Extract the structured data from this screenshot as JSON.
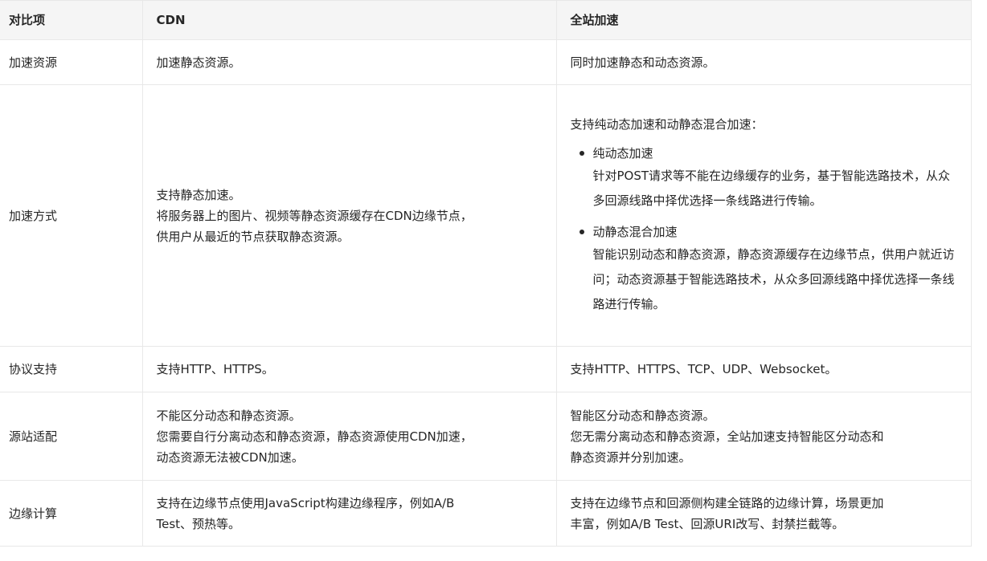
{
  "table": {
    "headers": [
      "对比项",
      "CDN",
      "全站加速"
    ],
    "rows": {
      "resource": {
        "item": "加速资源",
        "cdn": [
          "加速静态资源。"
        ],
        "dcdn": [
          "同时加速静态和动态资源。"
        ]
      },
      "method": {
        "item": "加速方式",
        "cdn": [
          "支持静态加速。",
          "将服务器上的图片、视频等静态资源缓存在CDN边缘节点，",
          "供用户从最近的节点获取静态资源。"
        ],
        "dcdn_intro": "支持纯动态加速和动静态混合加速：",
        "dcdn_points": [
          {
            "title": "纯动态加速",
            "desc": "针对POST请求等不能在边缘缓存的业务，基于智能选路技术，从众多回源线路中择优选择一条线路进行传输。"
          },
          {
            "title": "动静态混合加速",
            "desc": "智能识别动态和静态资源，静态资源缓存在边缘节点，供用户就近访问；动态资源基于智能选路技术，从众多回源线路中择优选择一条线路进行传输。"
          }
        ]
      },
      "protocol": {
        "item": "协议支持",
        "cdn": [
          "支持HTTP、HTTPS。"
        ],
        "dcdn": [
          "支持HTTP、HTTPS、TCP、UDP、Websocket。"
        ]
      },
      "origin": {
        "item": "源站适配",
        "cdn": [
          "不能区分动态和静态资源。",
          "您需要自行分离动态和静态资源，静态资源使用CDN加速，",
          "动态资源无法被CDN加速。"
        ],
        "dcdn": [
          "智能区分动态和静态资源。",
          "您无需分离动态和静态资源，全站加速支持智能区分动态和",
          "静态资源并分别加速。"
        ]
      },
      "edge": {
        "item": "边缘计算",
        "cdn": [
          "支持在边缘节点使用JavaScript构建边缘程序，例如A/B",
          "Test、预热等。"
        ],
        "dcdn": [
          "支持在边缘节点和回源侧构建全链路的边缘计算，场景更加",
          "丰富，例如A/B Test、回源URI改写、封禁拦截等。"
        ]
      }
    }
  }
}
